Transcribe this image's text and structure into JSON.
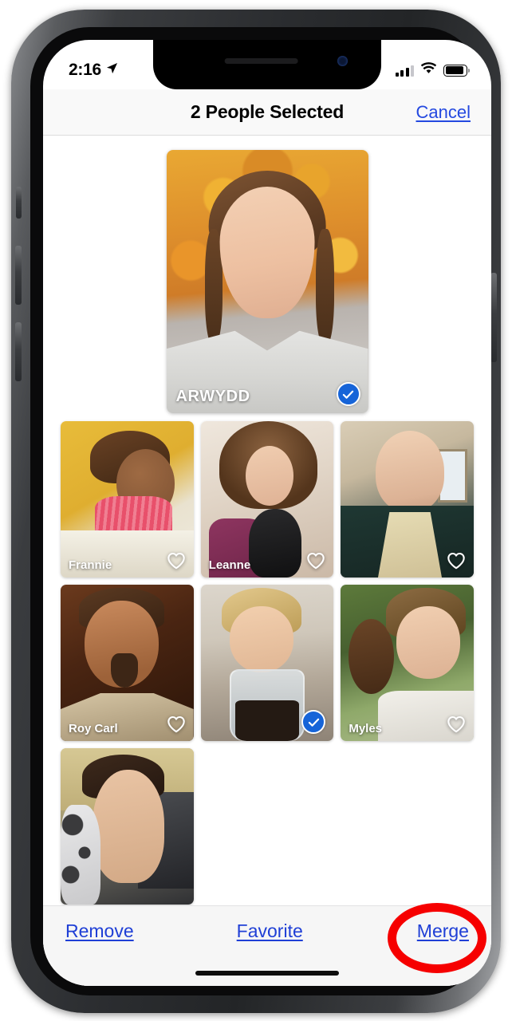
{
  "status_bar": {
    "time": "2:16",
    "location_icon": "location-arrow-icon",
    "signal_icon": "cellular-signal-icon",
    "wifi_icon": "wifi-icon",
    "battery_icon": "battery-icon"
  },
  "nav_bar": {
    "title": "2 People Selected",
    "cancel_label": "Cancel"
  },
  "featured": {
    "name": "ARWYDD",
    "selected": true,
    "check_icon": "checkmark-circle-icon"
  },
  "grid": [
    {
      "name": "Frannie",
      "selected": false,
      "badge_icon": "heart-outline-icon"
    },
    {
      "name": "Leanne",
      "selected": false,
      "badge_icon": "heart-outline-icon"
    },
    {
      "name": "",
      "selected": false,
      "badge_icon": "heart-outline-icon"
    },
    {
      "name": "Roy Carl",
      "selected": false,
      "badge_icon": "heart-outline-icon"
    },
    {
      "name": "",
      "selected": true,
      "badge_icon": "checkmark-circle-icon"
    },
    {
      "name": "Myles",
      "selected": false,
      "badge_icon": "heart-outline-icon"
    },
    {
      "name": "",
      "selected": false,
      "badge_icon": ""
    }
  ],
  "toolbar": {
    "remove_label": "Remove",
    "favorite_label": "Favorite",
    "merge_label": "Merge"
  },
  "annotation": {
    "shape": "red-ellipse-highlight",
    "target": "Merge",
    "color": "#f60000"
  },
  "colors": {
    "link_blue": "#2449e0",
    "selection_blue": "#1664d8",
    "toolbar_bg": "#f6f6f6",
    "nav_bg": "#f9f9f9",
    "annotation_red": "#f60000"
  }
}
